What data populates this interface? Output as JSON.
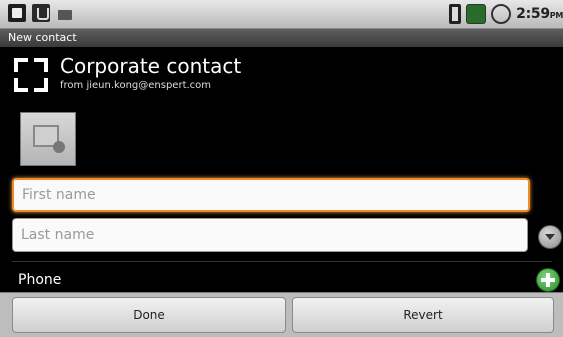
{
  "status_bar": {
    "icons": [
      "sdcard-icon",
      "usb-icon",
      "download-icon",
      "battery-icon",
      "signal-icon",
      "alarm-icon"
    ],
    "time": "2:59",
    "ampm": "PM"
  },
  "title_bar": {
    "title": "New contact"
  },
  "account": {
    "title": "Corporate contact",
    "subtitle": "from jieun.kong@enspert.com"
  },
  "photo": {
    "icon": "add-photo-icon"
  },
  "fields": {
    "first_name": {
      "placeholder": "First name",
      "value": ""
    },
    "last_name": {
      "placeholder": "Last name",
      "value": ""
    }
  },
  "sections": {
    "phone_label": "Phone"
  },
  "buttons": {
    "done": "Done",
    "revert": "Revert"
  },
  "colors": {
    "focus_outline": "#f08c28",
    "add_button": "#2a8a2a"
  }
}
